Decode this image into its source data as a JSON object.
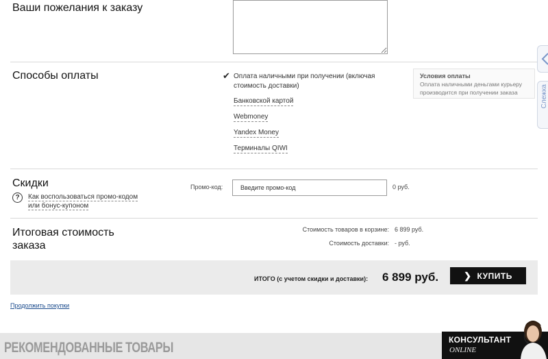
{
  "wishes": {
    "title": "Ваши пожелания к заказу",
    "value": ""
  },
  "payment": {
    "title": "Способы оплаты",
    "selected_option": "Оплата наличными при получении (включая стоимость доставки)",
    "selected_line1": "Оплата наличными при получении (включая",
    "selected_line2": "стоимость доставки)",
    "options": [
      "Банковской картой",
      "Webmoney",
      "Yandex Money",
      "Терминалы QIWI"
    ],
    "conditions": {
      "title": "Условия оплаты",
      "line1": "Оплата наличными деньгами курьеру",
      "line2": "производится при получении заказа"
    }
  },
  "discounts": {
    "title": "Скидки",
    "help_line1": "Как воспользоваться промо-кодом",
    "help_line2": "или бонус-купоном",
    "promo_label": "Промо-код:",
    "promo_placeholder": "Введите промо-код",
    "promo_sum": "0 руб."
  },
  "summary": {
    "title_line1": "Итоговая стоимость",
    "title_line2": "заказа",
    "cart_label": "Стоимость товаров в корзине:",
    "cart_value": "6 899 руб.",
    "delivery_label": "Стоимость доставки:",
    "delivery_value": "- руб."
  },
  "total": {
    "label": "ИТОГО (с учетом скидки и доставки):",
    "value": "6 899 руб.",
    "buy_label": "КУПИТЬ"
  },
  "continue_link": "Продолжить покупки",
  "recommended_title": "РЕКОМЕНДОВАННЫЕ ТОВАРЫ",
  "consultant": {
    "title": "КОНСУЛЬТАНТ",
    "subtitle": "ONLINE"
  },
  "side_tab": {
    "label": "Слежка"
  },
  "colors": {
    "accent_link": "#1a4a8c",
    "buy_button": "#111111",
    "side_tab_text": "#7a96c8"
  },
  "icons": {
    "check": "check-icon",
    "help": "question-circle-icon",
    "chevron": "chevron-right-icon",
    "side_arrow": "chevron-left-icon"
  }
}
